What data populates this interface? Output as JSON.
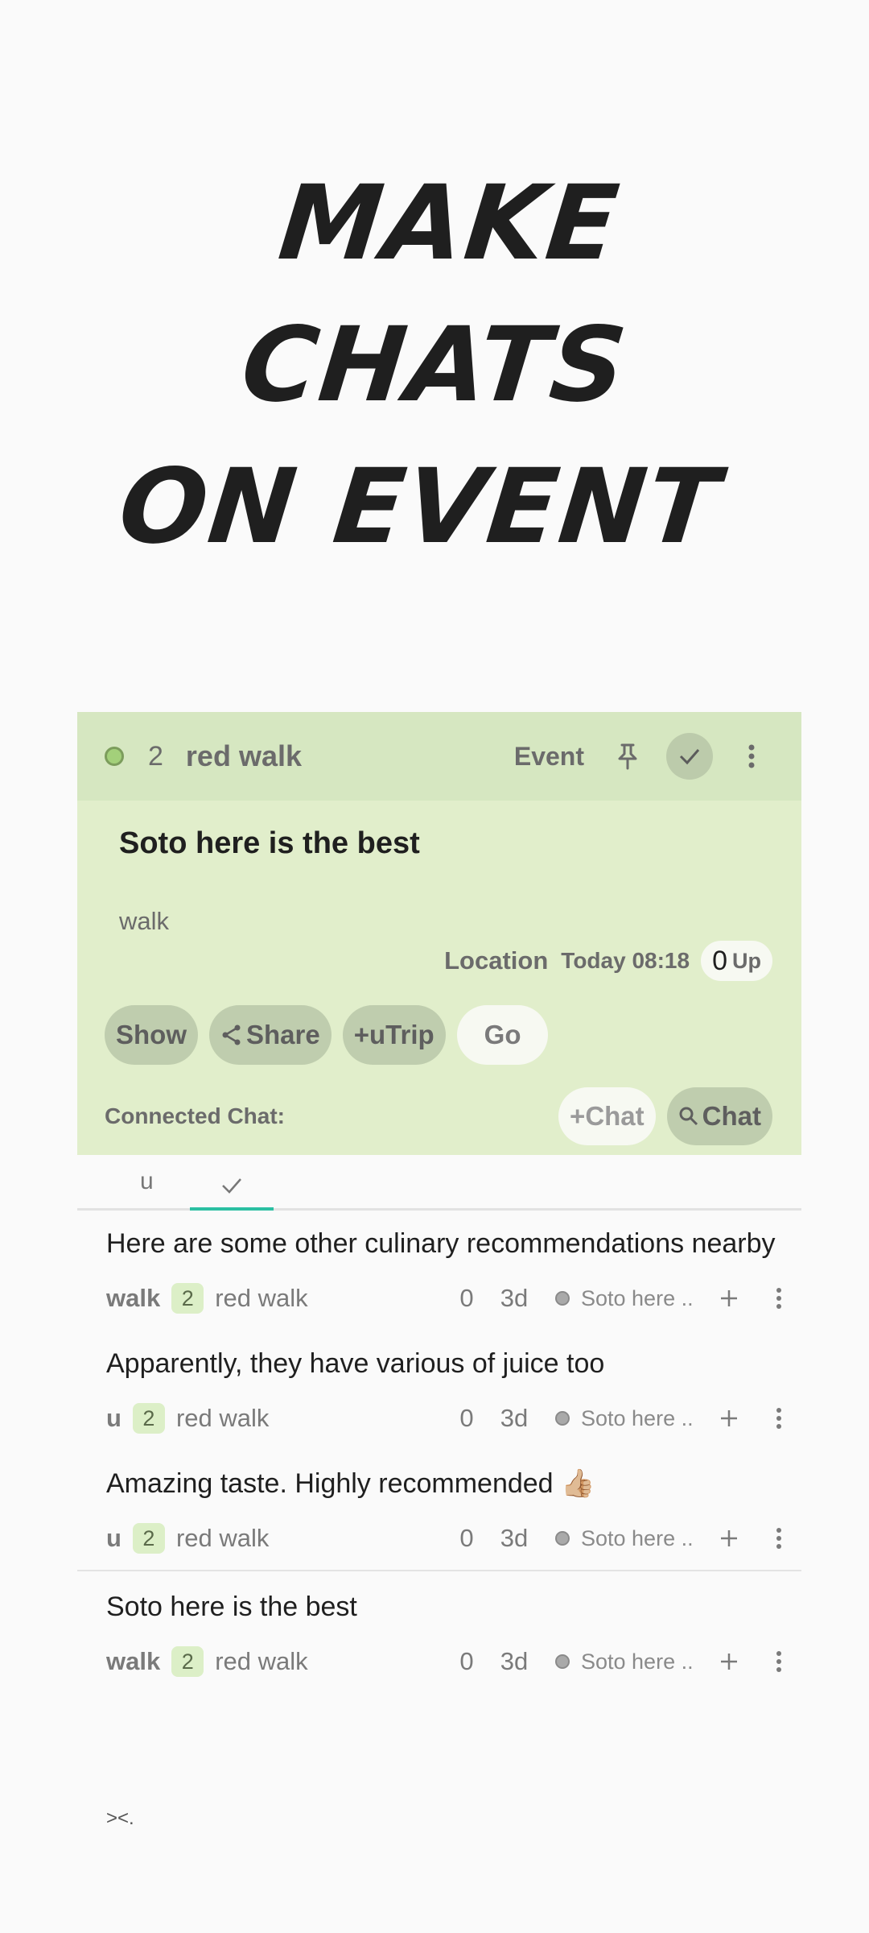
{
  "headline": {
    "line1": "MAKE",
    "line2": "CHATS",
    "line3": "ON EVENT"
  },
  "event_card": {
    "member_count": "2",
    "name": "red walk",
    "type_label": "Event",
    "title": "Soto here is the best",
    "tag": "walk",
    "location_label": "Location",
    "time": "Today 08:18",
    "up_count": "0",
    "up_label": "Up",
    "buttons": {
      "show": "Show",
      "share": "Share",
      "add_trip": "+uTrip",
      "go": "Go"
    },
    "connected_label": "Connected Chat:",
    "add_chat": "+Chat",
    "search_chat": "Chat",
    "colors": {
      "card_bg": "#e1eecb",
      "header_bg": "#d6e7c1",
      "status_dot": "#a3d07a"
    }
  },
  "tabs": {
    "first": "u",
    "active_indicator_color": "#2bbfa2"
  },
  "messages": [
    {
      "text": "Here are some other culinary recommendations nearby",
      "user": "walk",
      "count": "2",
      "chat": "red walk",
      "zero": "0",
      "age": "3d",
      "ref": "Soto here .."
    },
    {
      "text": "Apparently, they have various of juice too",
      "user": "u",
      "count": "2",
      "chat": "red walk",
      "zero": "0",
      "age": "3d",
      "ref": "Soto here .."
    },
    {
      "text": "Amazing taste. Highly recommended 👍🏼",
      "user": "u",
      "count": "2",
      "chat": "red walk",
      "zero": "0",
      "age": "3d",
      "ref": "Soto here .."
    },
    {
      "text": "Soto here is the best",
      "user": "walk",
      "count": "2",
      "chat": "red walk",
      "zero": "0",
      "age": "3d",
      "ref": "Soto here .."
    }
  ],
  "footer": "><."
}
